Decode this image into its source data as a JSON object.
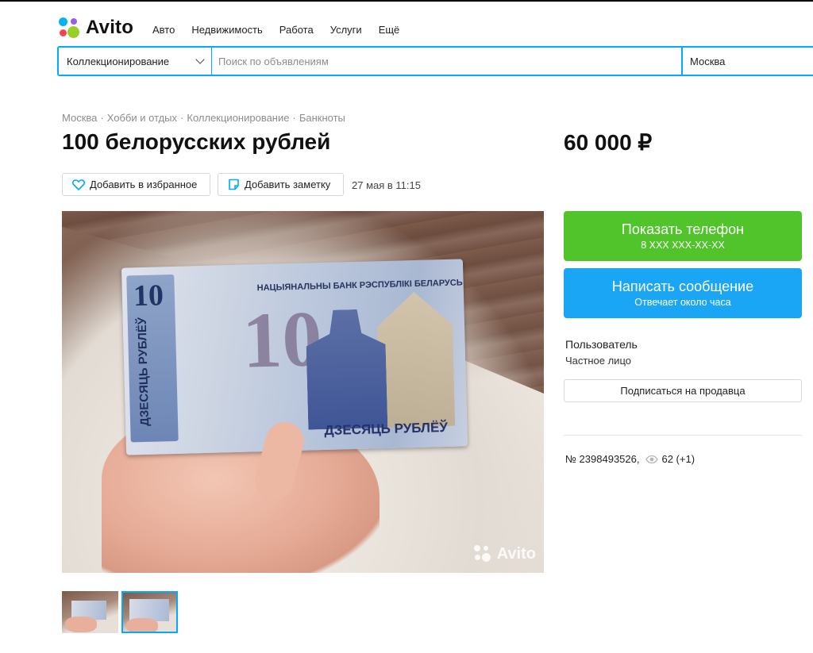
{
  "header": {
    "logo_text": "Avito",
    "nav": [
      "Авто",
      "Недвижимость",
      "Работа",
      "Услуги",
      "Ещё"
    ]
  },
  "search": {
    "category": "Коллекционирование",
    "placeholder": "Поиск по объявлениям",
    "city": "Москва"
  },
  "breadcrumb": [
    "Москва",
    "Хобби и отдых",
    "Коллекционирование",
    "Банкноты"
  ],
  "listing": {
    "title": "100 белорусских рублей",
    "price": "60 000 ₽",
    "favorite_label": "Добавить в избранное",
    "note_label": "Добавить заметку",
    "date": "27 мая в 11:15"
  },
  "photo": {
    "banknote_value": "10",
    "banknote_bank": "НАЦЫЯНАЛЬНЫ БАНК РЭСПУБЛІКІ БЕЛАРУСЬ",
    "banknote_text": "ДЗЕСЯЦЬ РУБЛЁЎ",
    "watermark": "Avito",
    "thumbnail_count": 2,
    "active_thumbnail": 2
  },
  "contact": {
    "phone_label": "Показать телефон",
    "phone_masked": "8 XXX XXX-XX-XX",
    "message_label": "Написать сообщение",
    "message_sub": "Отвечает около часа"
  },
  "seller": {
    "name": "Пользователь",
    "type": "Частное лицо",
    "subscribe_label": "Подписаться на продавца"
  },
  "meta": {
    "ad_number": "№ 2398493526,",
    "views": "62 (+1)"
  },
  "colors": {
    "accent_blue": "#00aaff",
    "phone_green": "#52c42b",
    "message_blue": "#1aa6f5"
  }
}
